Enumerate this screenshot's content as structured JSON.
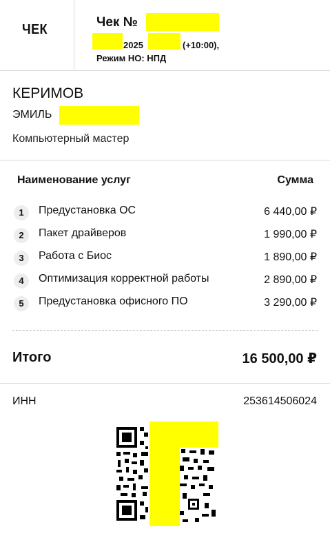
{
  "header": {
    "check_label": "ЧЕК",
    "receipt_title": "Чек №",
    "date_year": "2025",
    "timezone": "(+10:00),",
    "tax_mode": "Режим НО: НПД"
  },
  "seller": {
    "last_name": "КЕРИМОВ",
    "first_name": "ЭМИЛЬ",
    "profession": "Компьютерный мастер"
  },
  "services": {
    "col_name": "Наименование услуг",
    "col_sum": "Сумма",
    "items": [
      {
        "num": "1",
        "name": "Предустановка ОС",
        "amount": "6 440,00 ₽"
      },
      {
        "num": "2",
        "name": "Пакет драйверов",
        "amount": "1 990,00 ₽"
      },
      {
        "num": "3",
        "name": "Работа с Биос",
        "amount": "1 890,00 ₽"
      },
      {
        "num": "4",
        "name": "Оптимизация корректной работы",
        "amount": "2 890,00 ₽"
      },
      {
        "num": "5",
        "name": "Предустановка офисного ПО",
        "amount": "3 290,00 ₽"
      }
    ]
  },
  "total": {
    "label": "Итого",
    "amount": "16 500,00 ₽"
  },
  "inn": {
    "label": "ИНН",
    "value": "253614506024"
  },
  "colors": {
    "redaction": "#ffff00",
    "divider": "#d9d9d9",
    "badge_bg": "#ededed"
  }
}
